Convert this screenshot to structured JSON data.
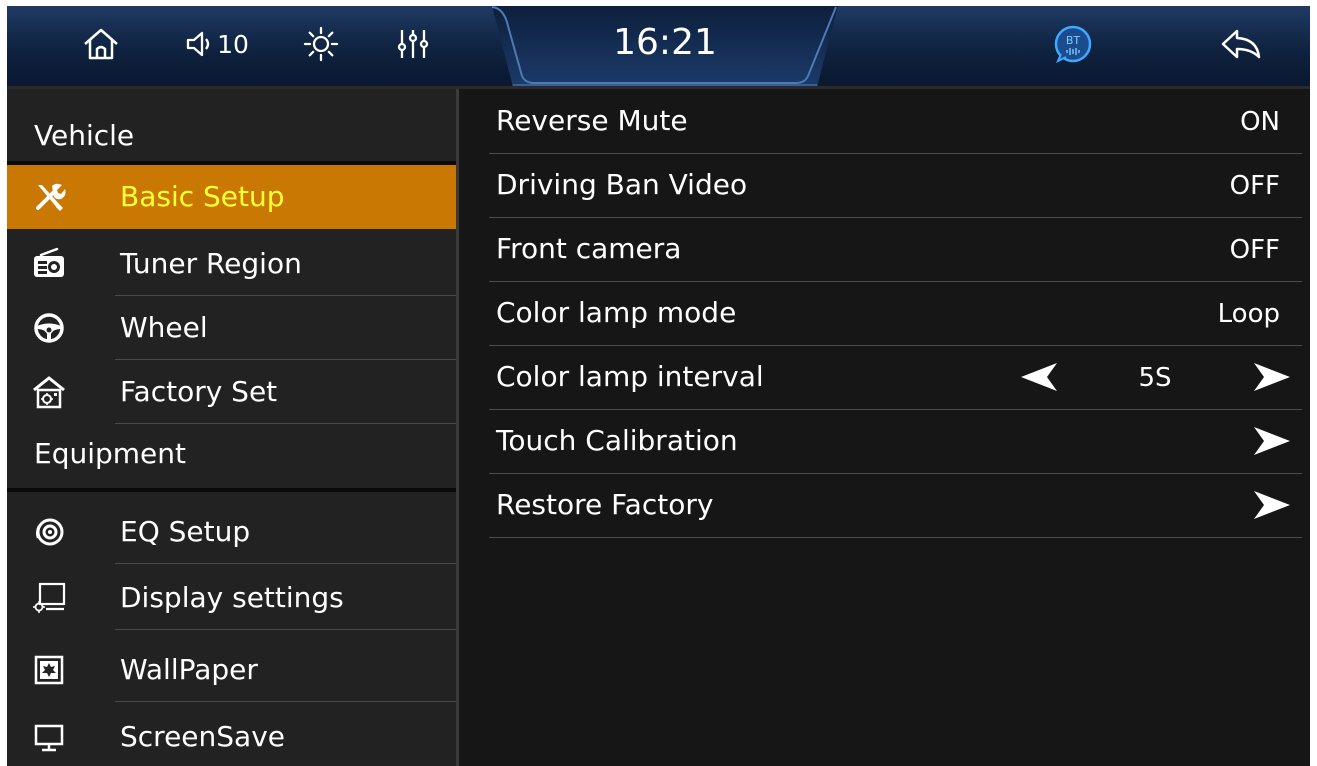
{
  "status_bar": {
    "volume": "10",
    "time": "16:21",
    "bt_label": "BT",
    "icons": [
      "home-icon",
      "volume-icon",
      "brightness-icon",
      "equalizer-icon",
      "bluetooth-icon",
      "back-icon"
    ]
  },
  "sidebar": {
    "vehicle_header": "Vehicle",
    "vehicle_items": [
      {
        "label": "Basic Setup",
        "icon": "tools-icon",
        "active": true
      },
      {
        "label": "Tuner Region",
        "icon": "radio-icon",
        "active": false
      },
      {
        "label": "Wheel",
        "icon": "steering-wheel-icon",
        "active": false
      },
      {
        "label": "Factory Set",
        "icon": "factory-house-icon",
        "active": false
      }
    ],
    "equipment_header": "Equipment",
    "equipment_items": [
      {
        "label": "EQ Setup",
        "icon": "speaker-icon"
      },
      {
        "label": "Display settings",
        "icon": "display-settings-icon"
      },
      {
        "label": "WallPaper",
        "icon": "wallpaper-icon"
      },
      {
        "label": "ScreenSave",
        "icon": "monitor-icon"
      }
    ]
  },
  "settings": [
    {
      "label": "Reverse Mute",
      "value": "ON"
    },
    {
      "label": "Driving Ban Video",
      "value": "OFF"
    },
    {
      "label": "Front camera",
      "value": "OFF"
    },
    {
      "label": "Color lamp mode",
      "value": "Loop"
    },
    {
      "label": "Color lamp interval",
      "value": "5S"
    },
    {
      "label": "Touch Calibration",
      "value": ""
    },
    {
      "label": "Restore Factory",
      "value": ""
    }
  ],
  "colors": {
    "active_item_bg": "#c97903",
    "active_item_text": "#ffff33",
    "status_bar": "#16305a",
    "background": "#161616"
  }
}
